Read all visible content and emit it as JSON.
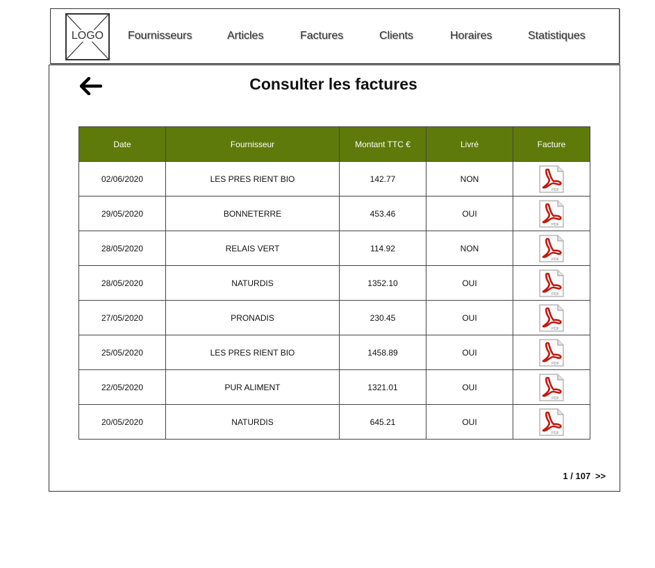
{
  "header": {
    "logo_text": "LOGO",
    "nav": [
      "Fournisseurs",
      "Articles",
      "Factures",
      "Clients",
      "Horaires",
      "Statistiques"
    ]
  },
  "page": {
    "title": "Consulter les factures",
    "back_icon": "left-arrow-icon"
  },
  "table": {
    "columns": [
      "Date",
      "Fournisseur",
      "Montant TTC €",
      "Livré",
      "Facture"
    ],
    "header_color": "#5e7a0a",
    "rows": [
      {
        "date": "02/06/2020",
        "fournisseur": "LES PRES RIENT BIO",
        "montant": "142.77",
        "livre": "NON",
        "facture_icon": "pdf-icon",
        "pdf_label": "PDF"
      },
      {
        "date": "29/05/2020",
        "fournisseur": "BONNETERRE",
        "montant": "453.46",
        "livre": "OUI",
        "facture_icon": "pdf-icon",
        "pdf_label": "PDF"
      },
      {
        "date": "28/05/2020",
        "fournisseur": "RELAIS VERT",
        "montant": "114.92",
        "livre": "NON",
        "facture_icon": "pdf-icon",
        "pdf_label": "PDF"
      },
      {
        "date": "28/05/2020",
        "fournisseur": "NATURDIS",
        "montant": "1352.10",
        "livre": "OUI",
        "facture_icon": "pdf-icon",
        "pdf_label": "PDF"
      },
      {
        "date": "27/05/2020",
        "fournisseur": "PRONADIS",
        "montant": "230.45",
        "livre": "OUI",
        "facture_icon": "pdf-icon",
        "pdf_label": "PDF"
      },
      {
        "date": "25/05/2020",
        "fournisseur": "LES PRES RIENT BIO",
        "montant": "1458.89",
        "livre": "OUI",
        "facture_icon": "pdf-icon",
        "pdf_label": "PDF"
      },
      {
        "date": "22/05/2020",
        "fournisseur": "PUR ALIMENT",
        "montant": "1321.01",
        "livre": "OUI",
        "facture_icon": "pdf-icon",
        "pdf_label": "PDF"
      },
      {
        "date": "20/05/2020",
        "fournisseur": "NATURDIS",
        "montant": "645.21",
        "livre": "OUI",
        "facture_icon": "pdf-icon",
        "pdf_label": "PDF"
      }
    ]
  },
  "pagination": {
    "current": "1",
    "separator": "/",
    "total": "107",
    "next_label": ">>"
  }
}
